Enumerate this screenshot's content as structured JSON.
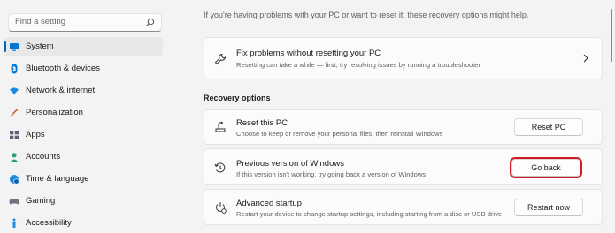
{
  "sidebar": {
    "search_placeholder": "Find a setting",
    "items": [
      {
        "label": "System",
        "icon": "monitor-icon"
      },
      {
        "label": "Bluetooth & devices",
        "icon": "bluetooth-icon"
      },
      {
        "label": "Network & internet",
        "icon": "wifi-icon"
      },
      {
        "label": "Personalization",
        "icon": "brush-icon"
      },
      {
        "label": "Apps",
        "icon": "apps-icon"
      },
      {
        "label": "Accounts",
        "icon": "person-icon"
      },
      {
        "label": "Time & language",
        "icon": "globe-clock-icon"
      },
      {
        "label": "Gaming",
        "icon": "gamepad-icon"
      },
      {
        "label": "Accessibility",
        "icon": "accessibility-icon"
      }
    ]
  },
  "main": {
    "intro": "If you're having problems with your PC or want to reset it, these recovery options might help.",
    "fix_card": {
      "title": "Fix problems without resetting your PC",
      "subtitle": "Resetting can take a while — first, try resolving issues by running a troubleshooter"
    },
    "section_title": "Recovery options",
    "options": [
      {
        "title": "Reset this PC",
        "subtitle": "Choose to keep or remove your personal files, then reinstall Windows",
        "button": "Reset PC"
      },
      {
        "title": "Previous version of Windows",
        "subtitle": "If this version isn't working, try going back a version of Windows",
        "button": "Go back"
      },
      {
        "title": "Advanced startup",
        "subtitle": "Restart your device to change startup settings, including starting from a disc or USB drive",
        "button": "Restart now"
      }
    ]
  },
  "colors": {
    "accent": "#0067c0",
    "highlight": "#d11a2a"
  }
}
